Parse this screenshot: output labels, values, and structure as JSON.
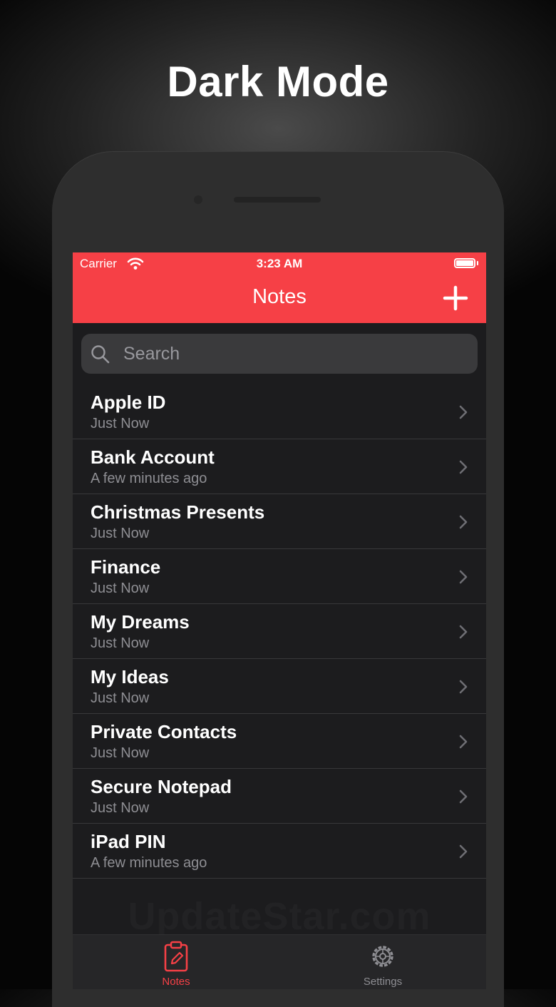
{
  "promo": {
    "headline": "Dark Mode"
  },
  "status_bar": {
    "carrier": "Carrier",
    "time": "3:23 AM"
  },
  "nav": {
    "title": "Notes",
    "add_icon": "plus-icon"
  },
  "search": {
    "placeholder": "Search",
    "icon": "search-icon"
  },
  "notes": [
    {
      "title": "Apple ID",
      "subtitle": "Just Now"
    },
    {
      "title": "Bank Account",
      "subtitle": "A few minutes ago"
    },
    {
      "title": "Christmas Presents",
      "subtitle": "Just Now"
    },
    {
      "title": "Finance",
      "subtitle": "Just Now"
    },
    {
      "title": "My Dreams",
      "subtitle": "Just Now"
    },
    {
      "title": "My Ideas",
      "subtitle": "Just Now"
    },
    {
      "title": "Private Contacts",
      "subtitle": "Just Now"
    },
    {
      "title": "Secure Notepad",
      "subtitle": "Just Now"
    },
    {
      "title": "iPad PIN",
      "subtitle": "A few minutes ago"
    }
  ],
  "watermark": "UpdateStar.com",
  "tabs": [
    {
      "label": "Notes",
      "icon": "clipboard-pencil-icon",
      "selected": true
    },
    {
      "label": "Settings",
      "icon": "gear-icon",
      "selected": false
    }
  ],
  "colors": {
    "accent": "#f64046",
    "background": "#1c1c1e",
    "secondary_text": "#8e8e93"
  }
}
